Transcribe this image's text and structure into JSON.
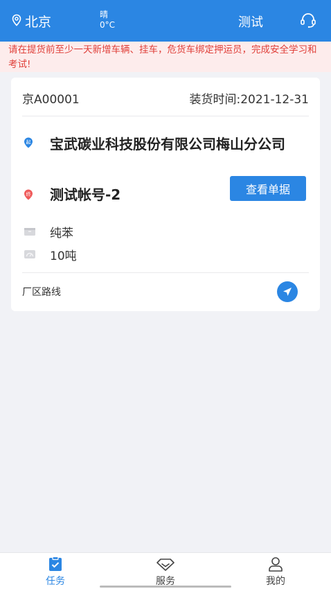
{
  "header": {
    "location": "北京",
    "weather": "晴",
    "temperature": "0°C",
    "user": "测试"
  },
  "notice": "请在提货前至少一天新增车辆、挂车，危货车绑定押运员，完成安全学习和考试!",
  "order": {
    "plate": "京A00001",
    "load_time_label": "装货时间:",
    "load_time": "2021-12-31",
    "start_badge": "起",
    "end_badge": "终",
    "company": "宝武碳业科技股份有限公司梅山分公司",
    "account": "测试帐号-2",
    "view_button": "查看单据",
    "goods": "纯苯",
    "weight": "10吨",
    "route_label": "厂区路线"
  },
  "tabbar": {
    "tabs": [
      {
        "label": "任务",
        "icon": "task-icon",
        "active": true
      },
      {
        "label": "服务",
        "icon": "diamond-icon",
        "active": false
      },
      {
        "label": "我的",
        "icon": "person-icon",
        "active": false
      }
    ]
  },
  "colors": {
    "primary": "#2b86e3",
    "notice_text": "#e0403a",
    "notice_bg": "#fdecec",
    "start_pin": "#2b86e3",
    "end_pin": "#ef5a5a"
  }
}
